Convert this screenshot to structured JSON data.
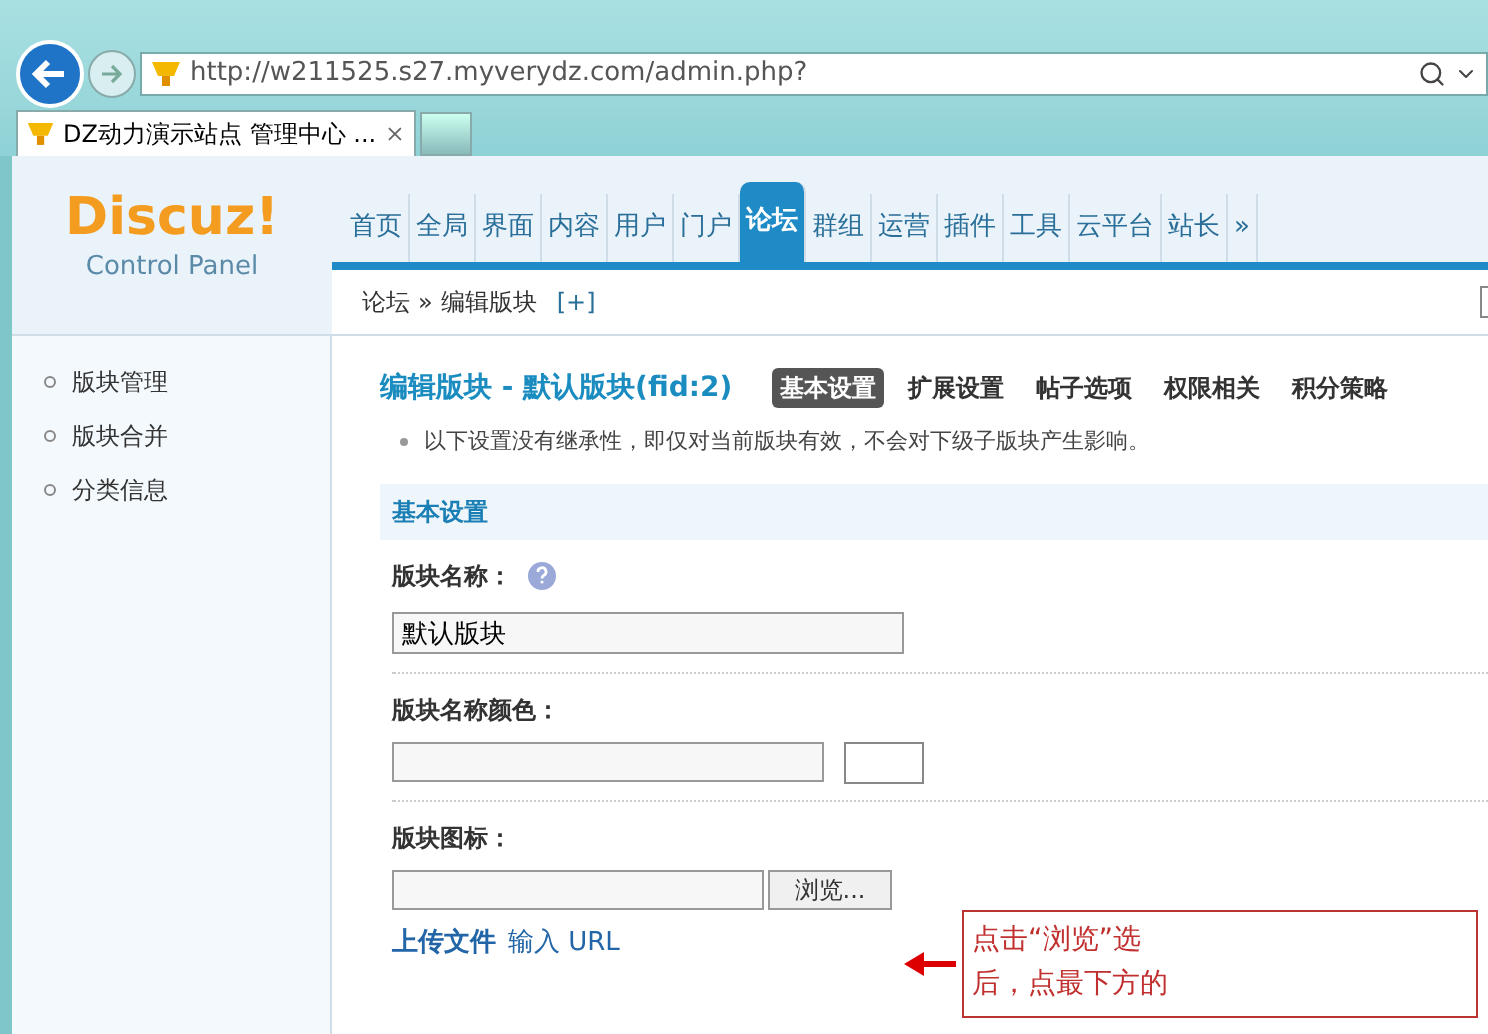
{
  "browser": {
    "address": "http://w211525.s27.myverydz.com/admin.php?",
    "tabs": [
      {
        "title": "DZ动力演示站点 管理中心 ...",
        "selected": true
      }
    ]
  },
  "logo": {
    "brand": "Discuz!",
    "subtitle": "Control Panel"
  },
  "nav": [
    {
      "label": "首页",
      "selected": false
    },
    {
      "label": "全局",
      "selected": false
    },
    {
      "label": "界面",
      "selected": false
    },
    {
      "label": "内容",
      "selected": false
    },
    {
      "label": "用户",
      "selected": false
    },
    {
      "label": "门户",
      "selected": false
    },
    {
      "label": "论坛",
      "selected": true
    },
    {
      "label": "群组",
      "selected": false
    },
    {
      "label": "运营",
      "selected": false
    },
    {
      "label": "插件",
      "selected": false
    },
    {
      "label": "工具",
      "selected": false
    },
    {
      "label": "云平台",
      "selected": false
    },
    {
      "label": "站长",
      "selected": false
    },
    {
      "label": "»",
      "selected": false
    }
  ],
  "breadcrumb": {
    "crumbs": [
      "论坛",
      "编辑版块"
    ],
    "separator": "»",
    "add": "[+]"
  },
  "sidebar": [
    {
      "label": "版块管理"
    },
    {
      "label": "版块合并"
    },
    {
      "label": "分类信息"
    }
  ],
  "page": {
    "title": "编辑版块 - 默认版块(fid:2)",
    "tabs": [
      {
        "label": "基本设置",
        "selected": true
      },
      {
        "label": "扩展设置",
        "selected": false
      },
      {
        "label": "帖子选项",
        "selected": false
      },
      {
        "label": "权限相关",
        "selected": false
      },
      {
        "label": "积分策略",
        "selected": false
      }
    ]
  },
  "note": "以下设置没有继承性，即仅对当前版块有效，不会对下级子版块产生影响。",
  "section": "基本设置",
  "fields": [
    {
      "kind": "text",
      "label": "版块名称：",
      "help": true,
      "value": "默认版块"
    },
    {
      "kind": "color",
      "label": "版块名称颜色：",
      "help": false
    },
    {
      "kind": "file",
      "label": "版块图标：",
      "help": false,
      "button": "浏览...",
      "links": [
        {
          "label": "上传文件",
          "selected": true
        },
        {
          "label": "输入 URL",
          "selected": false
        }
      ]
    }
  ],
  "callout": {
    "lines": [
      "点击“浏览”选",
      "后，点最下方的"
    ]
  }
}
